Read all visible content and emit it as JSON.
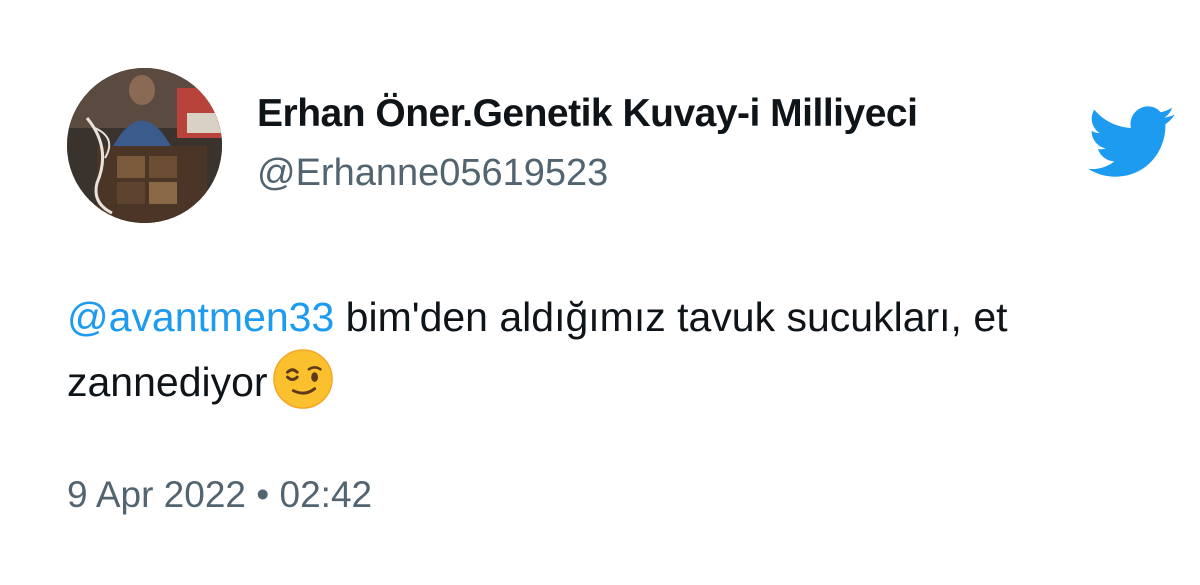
{
  "user": {
    "display_name": "Erhan Öner.Genetik Kuvay-i Milliyeci",
    "handle": "@Erhanne05619523",
    "avatar_icon": "profile-photo"
  },
  "tweet": {
    "mention": "@avantmen33",
    "text": " bim'den aldığımız tavuk sucukları, et zannediyor",
    "emoji_icon": "winking-face-emoji",
    "date": "9 Apr 2022",
    "separator": "•",
    "time": "02:42"
  },
  "brand": {
    "logo_icon": "twitter-bird-icon",
    "accent_color": "#1d9bf0"
  },
  "colors": {
    "name_text": "#0f1419",
    "secondary_text": "#536471",
    "background": "#ffffff"
  }
}
